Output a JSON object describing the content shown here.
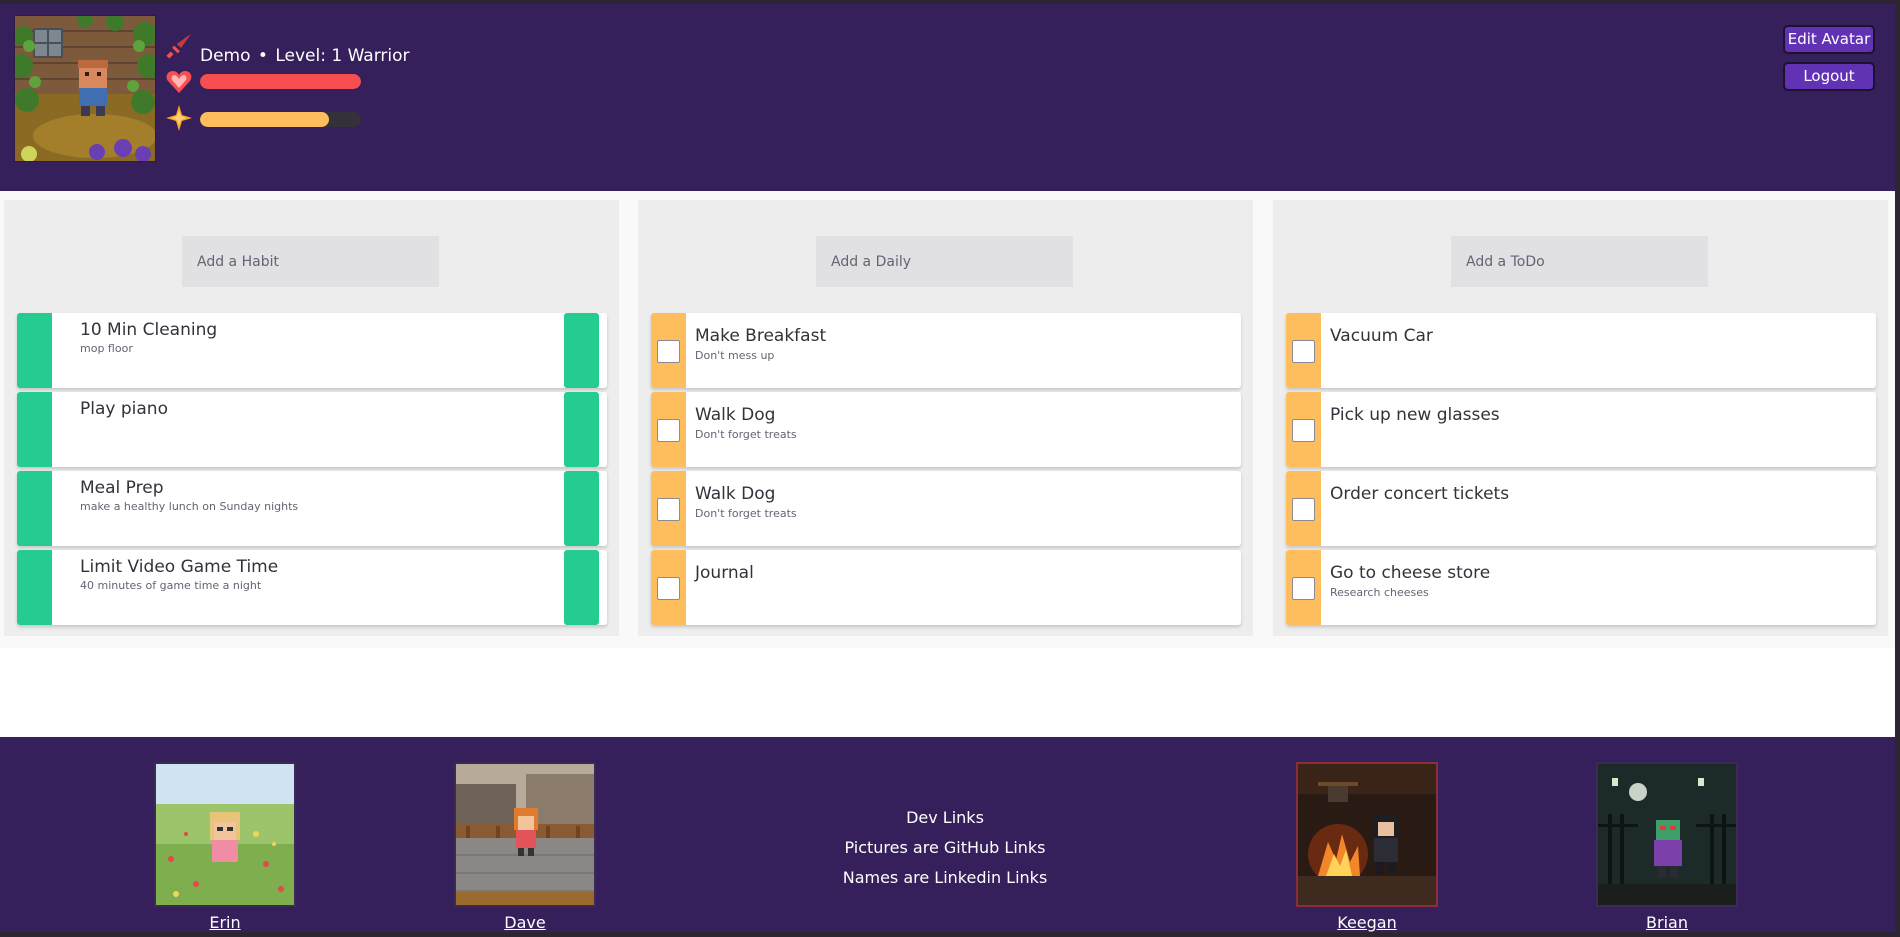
{
  "header": {
    "user_name": "Demo",
    "separator": "•",
    "level_text": "Level: 1 Warrior",
    "hp_fraction": 1.0,
    "xp_fraction": 0.8,
    "edit_avatar_label": "Edit Avatar",
    "logout_label": "Logout"
  },
  "habits": {
    "placeholder": "Add a Habit",
    "items": [
      {
        "title": "10 Min Cleaning",
        "notes": "mop floor"
      },
      {
        "title": "Play piano",
        "notes": ""
      },
      {
        "title": "Meal Prep",
        "notes": "make a healthy lunch on Sunday nights"
      },
      {
        "title": "Limit Video Game Time",
        "notes": "40 minutes of game time a night"
      }
    ]
  },
  "dailies": {
    "placeholder": "Add a Daily",
    "items": [
      {
        "title": "Make Breakfast",
        "notes": "Don't mess up"
      },
      {
        "title": "Walk Dog",
        "notes": "Don't forget treats"
      },
      {
        "title": "Walk Dog",
        "notes": "Don't forget treats"
      },
      {
        "title": "Journal",
        "notes": ""
      }
    ]
  },
  "todos": {
    "placeholder": "Add a ToDo",
    "items": [
      {
        "title": "Vacuum Car",
        "notes": ""
      },
      {
        "title": "Pick up new glasses",
        "notes": ""
      },
      {
        "title": "Order concert tickets",
        "notes": ""
      },
      {
        "title": "Go to cheese store",
        "notes": "Research cheeses"
      }
    ]
  },
  "footer": {
    "devs": [
      {
        "name": "Erin"
      },
      {
        "name": "Dave"
      },
      {
        "name": "Keegan"
      },
      {
        "name": "Brian"
      }
    ],
    "center_lines": [
      "Dev Links",
      "Pictures are GitHub Links",
      "Names are Linkedin Links"
    ]
  },
  "colors": {
    "header_bg": "#36205b",
    "button_bg": "#6133b4",
    "habit_green": "#24cc8f",
    "daily_yellow": "#ffbe5d",
    "hp_red": "#f74e52",
    "xp_yellow": "#ffbe5d"
  },
  "icons": {
    "sword": "sword-icon",
    "heart": "heart-icon",
    "star": "star-icon",
    "checkbox": "checkbox-icon"
  }
}
